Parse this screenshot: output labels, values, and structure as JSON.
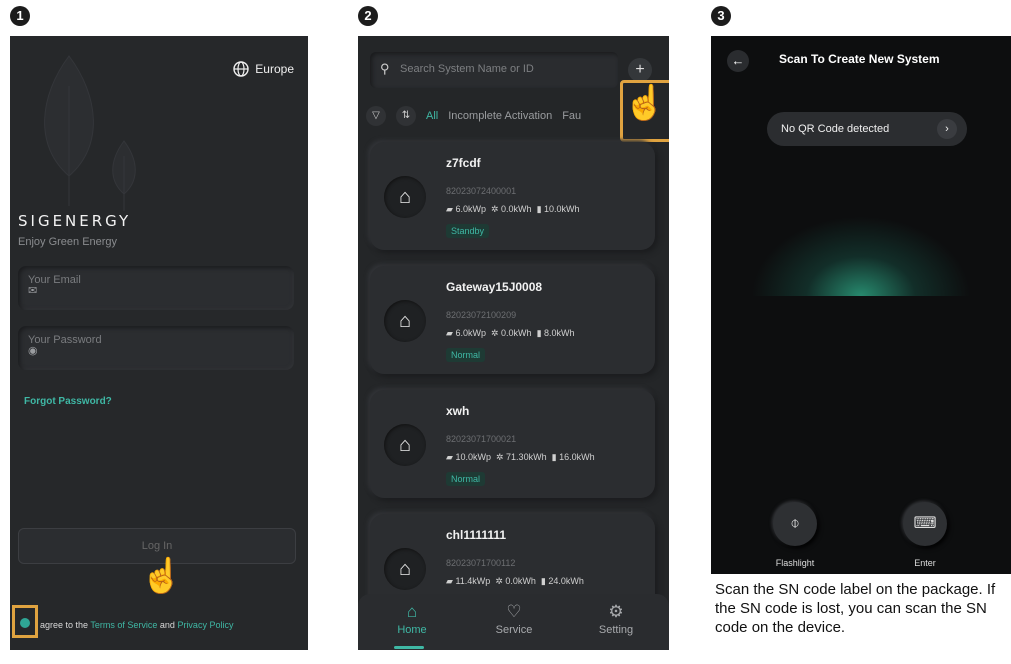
{
  "steps": [
    "1",
    "2",
    "3"
  ],
  "screen1": {
    "region": "Europe",
    "logo": "SIGENERGY",
    "tagline": "Enjoy Green Energy",
    "email_placeholder": "Your Email",
    "password_placeholder": "Your Password",
    "forgot": "Forgot Password?",
    "login_label": "Log In",
    "agree_prefix": "agree to the ",
    "terms": "Terms of Service",
    "agree_and": " and ",
    "privacy": "Privacy Policy"
  },
  "screen2": {
    "search_placeholder": "Search System Name or ID",
    "filters": {
      "all": "All",
      "incomplete": "Incomplete Activation",
      "fault": "Fau"
    },
    "systems": [
      {
        "name": "z7fcdf",
        "sn": "82023072400001",
        "pv": "6.0kWp",
        "gen": "0.0kWh",
        "bat": "10.0kWh",
        "status": "Standby"
      },
      {
        "name": "Gateway15J0008",
        "sn": "82023072100209",
        "pv": "6.0kWp",
        "gen": "0.0kWh",
        "bat": "8.0kWh",
        "status": "Normal"
      },
      {
        "name": "xwh",
        "sn": "82023071700021",
        "pv": "10.0kWp",
        "gen": "71.30kWh",
        "bat": "16.0kWh",
        "status": "Normal"
      },
      {
        "name": "chl1111111",
        "sn": "82023071700112",
        "pv": "11.4kWp",
        "gen": "0.0kWh",
        "bat": "24.0kWh",
        "status": ""
      }
    ],
    "tabs": {
      "home": "Home",
      "service": "Service",
      "setting": "Setting"
    }
  },
  "screen3": {
    "title": "Scan To Create New System",
    "qr_status": "No QR Code detected",
    "flashlight": "Flashlight",
    "enter": "Enter",
    "caption": "Scan the SN code label on the package. If the SN code is lost, you can scan the SN code on the device."
  }
}
